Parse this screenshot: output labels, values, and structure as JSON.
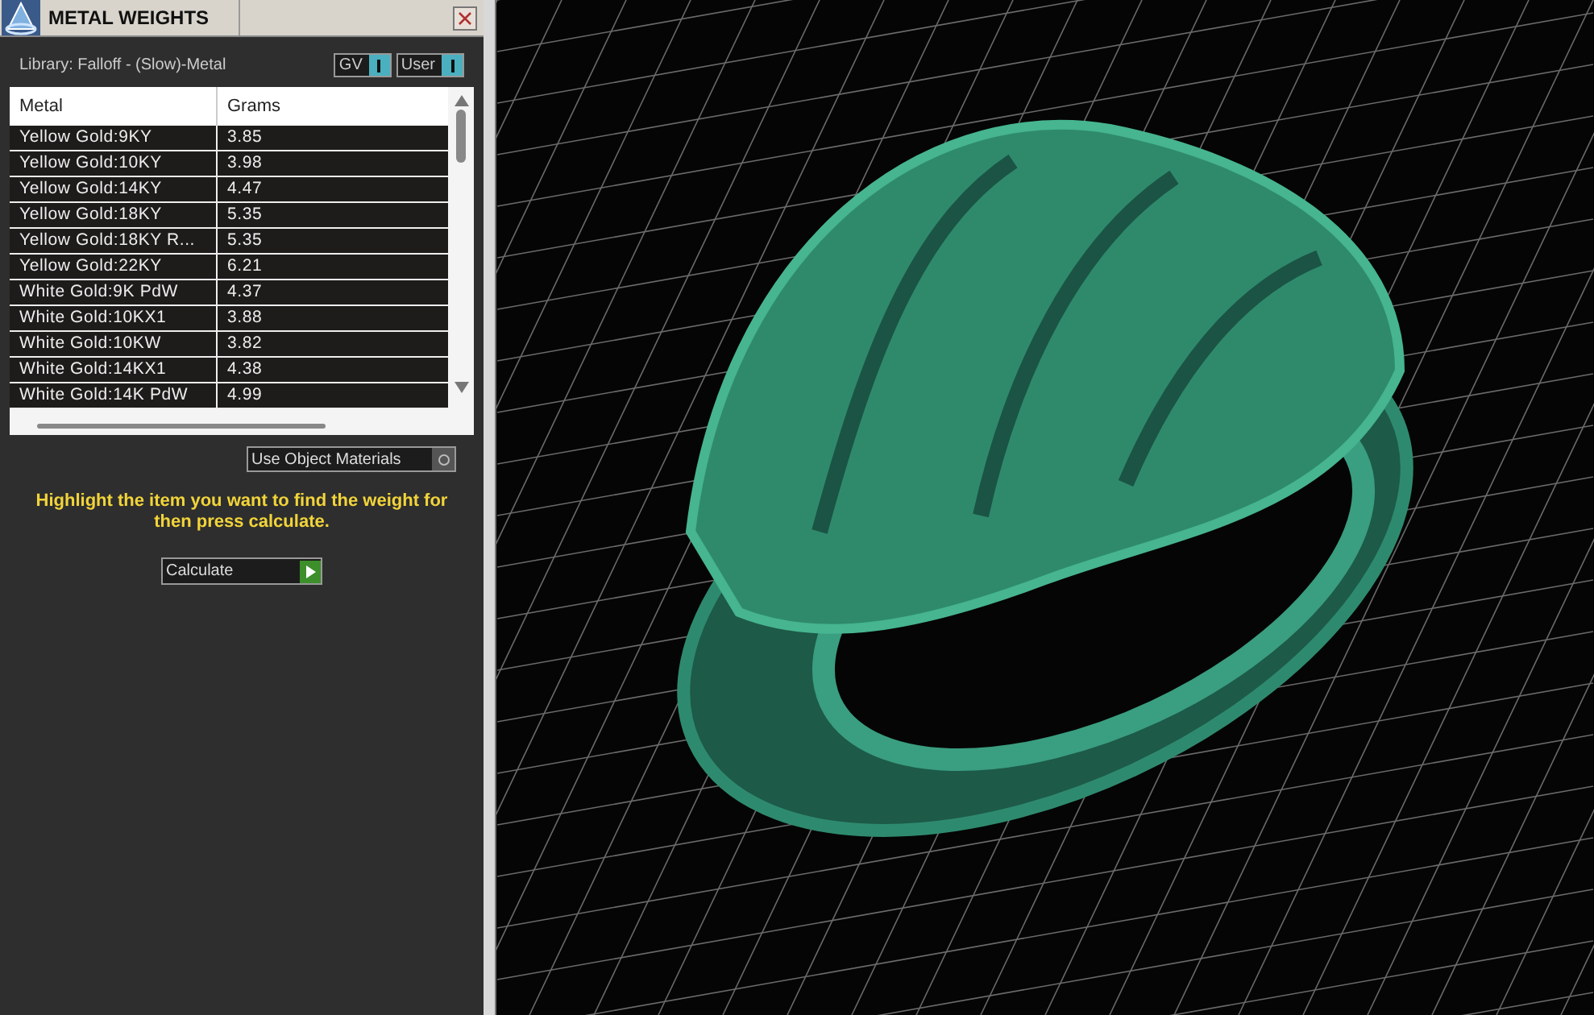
{
  "window": {
    "title": "METAL WEIGHTS"
  },
  "library_label": "Library: Falloff - (Slow)-Metal",
  "toggles": [
    {
      "label": "GV",
      "on": true
    },
    {
      "label": "User",
      "on": true
    }
  ],
  "table": {
    "columns": [
      "Metal",
      "Grams"
    ],
    "rows": [
      [
        "Yellow Gold:9KY",
        "3.85"
      ],
      [
        "Yellow Gold:10KY",
        "3.98"
      ],
      [
        "Yellow Gold:14KY",
        "4.47"
      ],
      [
        "Yellow Gold:18KY",
        "5.35"
      ],
      [
        "Yellow Gold:18KY R...",
        "5.35"
      ],
      [
        "Yellow Gold:22KY",
        "6.21"
      ],
      [
        "White Gold:9K PdW",
        "4.37"
      ],
      [
        "White Gold:10KX1",
        "3.88"
      ],
      [
        "White Gold:10KW",
        "3.82"
      ],
      [
        "White Gold:14KX1",
        "4.38"
      ],
      [
        "White Gold:14K PdW",
        "4.99"
      ]
    ]
  },
  "use_object_materials": {
    "label": "Use Object Materials",
    "checked": false
  },
  "hint": "Highlight the item you want to find the weight for then press calculate.",
  "calculate_button": {
    "label": "Calculate"
  }
}
